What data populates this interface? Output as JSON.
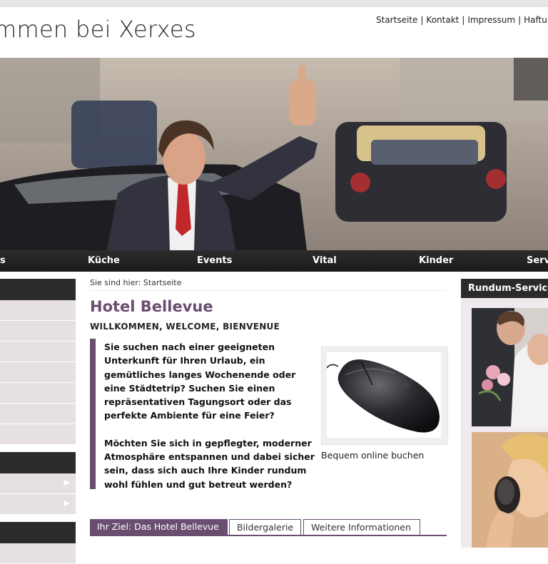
{
  "header": {
    "welcome_text": "mmen bei Xerxes",
    "top_links": [
      "Startseite",
      "Kontakt",
      "Impressum",
      "Haftung"
    ],
    "separator": "|"
  },
  "main_nav": {
    "items": [
      "s",
      "Küche",
      "Events",
      "Vital",
      "Kinder",
      "Serv"
    ]
  },
  "breadcrumb": {
    "prefix": "Sie sind hier:",
    "current": "Startseite"
  },
  "content": {
    "title": "Hotel Bellevue",
    "subtitle": "WILLKOMMEN, WELCOME, BIENVENUE",
    "paragraph1": "Sie suchen nach einer geeigneten Unterkunft für Ihren Urlaub, ein gemütliches langes Wochenende oder eine Städtetrip? Suchen Sie einen repräsentativen Tagungsort oder das perfekte Ambiente für eine Feier?",
    "paragraph2": "Möchten Sie sich in gepflegter, moderner Atmosphäre entspannen und dabei sicher sein, dass sich auch Ihre Kinder rundum wohl fühlen und gut betreut werden?",
    "image_caption": "Bequem online buchen",
    "tabs": [
      "Ihr Ziel: Das Hotel Bellevue",
      "Bildergalerie",
      "Weitere Informationen"
    ]
  },
  "right_column": {
    "heading": "Rundum-Service"
  },
  "left_sidebar": {
    "arrow_glyph": "▶"
  },
  "colors": {
    "accent_purple": "#6a4e72",
    "nav_dark": "#1f1f1f",
    "sidebar_light": "#e6dfe4"
  }
}
